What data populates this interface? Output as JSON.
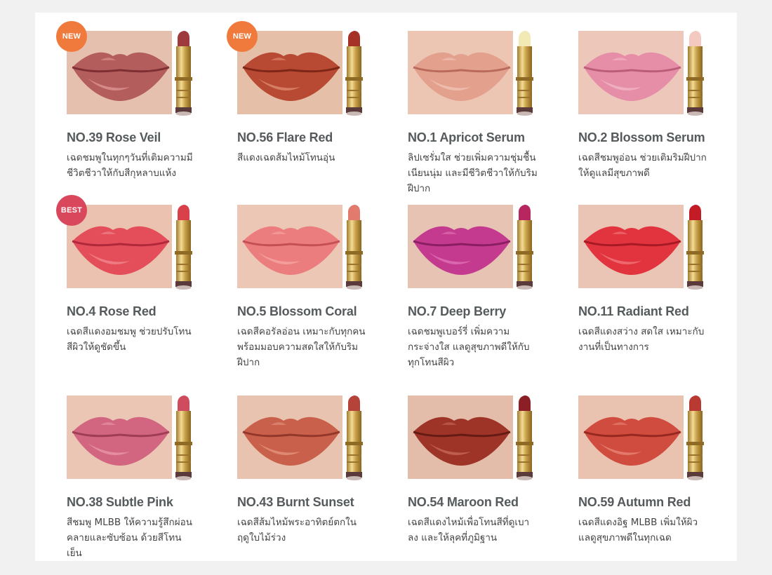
{
  "products": [
    {
      "name": "NO.39 Rose Veil",
      "desc": "เฉดชมพูในทุกๆวันที่เติมความมีชีวิตชีวาให้กับสีกุหลาบแห้ง",
      "badge": "NEW",
      "badge_color": "#f07a3c",
      "bg": "#e6c0ae",
      "lip": "#b45d5d",
      "lip_dark": "#7d2f33",
      "lip_hi": "#e7a1a0",
      "cap": "#9e3a3e"
    },
    {
      "name": "NO.56 Flare Red",
      "desc": "สีแดงเฉดส้มไหม้โทนอุ่น",
      "badge": "NEW",
      "badge_color": "#f07a3c",
      "bg": "#e6bfa8",
      "lip": "#b84a34",
      "lip_dark": "#7e2616",
      "lip_hi": "#e79a7e",
      "cap": "#a63227"
    },
    {
      "name": "NO.1 Apricot Serum",
      "desc": "ลิปเซรั่มใส ช่วยเพิ่มความชุ่มชื้นเนียนนุ่ม และมีชีวิตชีวาให้กับริมฝีปาก",
      "badge": "",
      "badge_color": "",
      "bg": "#ecc6b3",
      "lip": "#e3a08c",
      "lip_dark": "#b96a5c",
      "lip_hi": "#f4cbbd",
      "cap": "#f3e9b5"
    },
    {
      "name": "NO.2 Blossom Serum",
      "desc": "เฉดสีชมพูอ่อน ช่วยเติมริมฝีปากให้ดูแลมีสุขภาพดี",
      "badge": "",
      "badge_color": "",
      "bg": "#eec7bb",
      "lip": "#e68ea7",
      "lip_dark": "#bb5c79",
      "lip_hi": "#f5c0cf",
      "cap": "#f4c9c2"
    },
    {
      "name": "NO.4 Rose Red",
      "desc": "เฉดสีแดงอมชมพู ช่วยปรับโทนสีผิวให้ดูชัดขึ้น",
      "badge": "BEST",
      "badge_color": "#d9475c",
      "bg": "#eac2af",
      "lip": "#e34e5a",
      "lip_dark": "#b0283a",
      "lip_hi": "#f4939a",
      "cap": "#d8404a"
    },
    {
      "name": "NO.5 Blossom Coral",
      "desc": "เฉดสีคอรัลอ่อน เหมาะกับทุกคนพร้อมมอบความสดใสให้กับริมฝีปาก",
      "badge": "",
      "badge_color": "",
      "bg": "#ecc7b6",
      "lip": "#ec7d7f",
      "lip_dark": "#c44f55",
      "lip_hi": "#f7b0ae",
      "cap": "#e27b6e"
    },
    {
      "name": "NO.7 Deep Berry",
      "desc": "เฉดชมพูเบอร์รี่ เพิ่มความกระจ่างใส แลดูสุขภาพดีให้กับทุกโทนสีผิว",
      "badge": "",
      "badge_color": "",
      "bg": "#e7c3b3",
      "lip": "#c43a8f",
      "lip_dark": "#8b1d63",
      "lip_hi": "#e47fbe",
      "cap": "#b8265f"
    },
    {
      "name": "NO.11 Radiant Red",
      "desc": "เฉดสีแดงสว่าง สดใส เหมาะกับงานที่เป็นทางการ",
      "badge": "",
      "badge_color": "",
      "bg": "#eac5b5",
      "lip": "#e2343f",
      "lip_dark": "#a71a24",
      "lip_hi": "#f48588",
      "cap": "#c41c26"
    },
    {
      "name": "NO.38 Subtle Pink",
      "desc": "สีชมพู MLBB ให้ความรู้สึกผ่อนคลายและซับซ้อน ด้วยสีโทนเย็น",
      "badge": "",
      "badge_color": "",
      "bg": "#ebc6b5",
      "lip": "#d26580",
      "lip_dark": "#9f3c56",
      "lip_hi": "#eea3b4",
      "cap": "#cf4c5e"
    },
    {
      "name": "NO.43 Burnt Sunset",
      "desc": "เฉดสีส้มไหม้พระอาทิตย์ตกในฤดูใบไม้ร่วง",
      "badge": "",
      "badge_color": "",
      "bg": "#e8c3b0",
      "lip": "#c9604b",
      "lip_dark": "#93372a",
      "lip_hi": "#e8a08b",
      "cap": "#b6433a"
    },
    {
      "name": "NO.54 Maroon Red",
      "desc": "เฉดสีแดงไหม้เพื่อโทนสีที่ดูเบาลง และให้ลุคที่ภูมิฐาน",
      "badge": "",
      "badge_color": "",
      "bg": "#e3bda9",
      "lip": "#9e3327",
      "lip_dark": "#661a14",
      "lip_hi": "#cf7563",
      "cap": "#8c1f26"
    },
    {
      "name": "NO.59 Autumn Red",
      "desc": "เฉดสีแดงอิฐ MLBB เพิ่มให้ผิวแลดูสุขภาพดีในทุกเฉด",
      "badge": "",
      "badge_color": "",
      "bg": "#e9c3b0",
      "lip": "#cf4c3f",
      "lip_dark": "#97281f",
      "lip_hi": "#ec9283",
      "cap": "#b93a33"
    }
  ]
}
